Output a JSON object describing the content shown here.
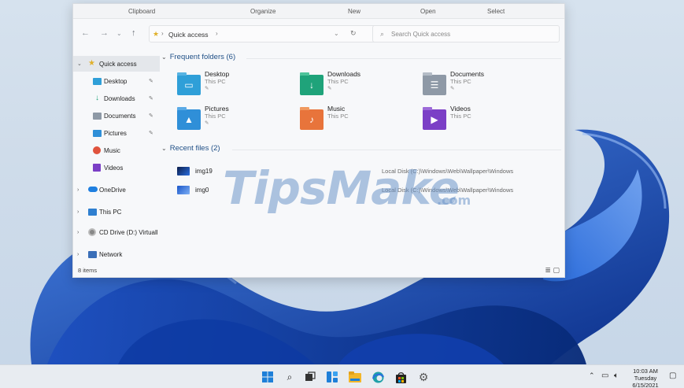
{
  "ribbon": {
    "groups": [
      "Clipboard",
      "Organize",
      "New",
      "Open",
      "Select"
    ]
  },
  "address": {
    "path": "Quick access",
    "search_placeholder": "Search Quick access"
  },
  "nav": {
    "quick_access": "Quick access",
    "pinned": [
      "Desktop",
      "Downloads",
      "Documents",
      "Pictures"
    ],
    "music": "Music",
    "videos": "Videos",
    "onedrive": "OneDrive",
    "this_pc": "This PC",
    "cd_drive": "CD Drive (D:) Virtuall",
    "network": "Network"
  },
  "content": {
    "frequent_header": "Frequent folders (6)",
    "folders": [
      {
        "name": "Desktop",
        "location": "This PC",
        "color": "#2f9fd8",
        "icon": "desktop-folder-icon"
      },
      {
        "name": "Downloads",
        "location": "This PC",
        "color": "#1fa37a",
        "icon": "downloads-folder-icon"
      },
      {
        "name": "Documents",
        "location": "This PC",
        "color": "#8e99a6",
        "icon": "documents-folder-icon"
      },
      {
        "name": "Pictures",
        "location": "This PC",
        "color": "#2f8fd8",
        "icon": "pictures-folder-icon"
      },
      {
        "name": "Music",
        "location": "This PC",
        "color": "#e8743b",
        "icon": "music-folder-icon"
      },
      {
        "name": "Videos",
        "location": "This PC",
        "color": "#7b3fc6",
        "icon": "videos-folder-icon"
      }
    ],
    "recent_header": "Recent files (2)",
    "recent": [
      {
        "name": "img19",
        "path": "Local Disk (C:)\\Windows\\Web\\Wallpaper\\Windows"
      },
      {
        "name": "img0",
        "path": "Local Disk (C:)\\Windows\\Web\\Wallpaper\\Windows"
      }
    ]
  },
  "status": {
    "items": "8 items"
  },
  "watermark": {
    "main": "TipsMake",
    "suffix": ".com"
  },
  "taskbar": {
    "time": "10:03 AM",
    "day": "Tuesday",
    "date": "6/15/2021"
  },
  "colors": {
    "accent": "#1f4f86",
    "wallpaper_blue": "#1a56c9"
  }
}
